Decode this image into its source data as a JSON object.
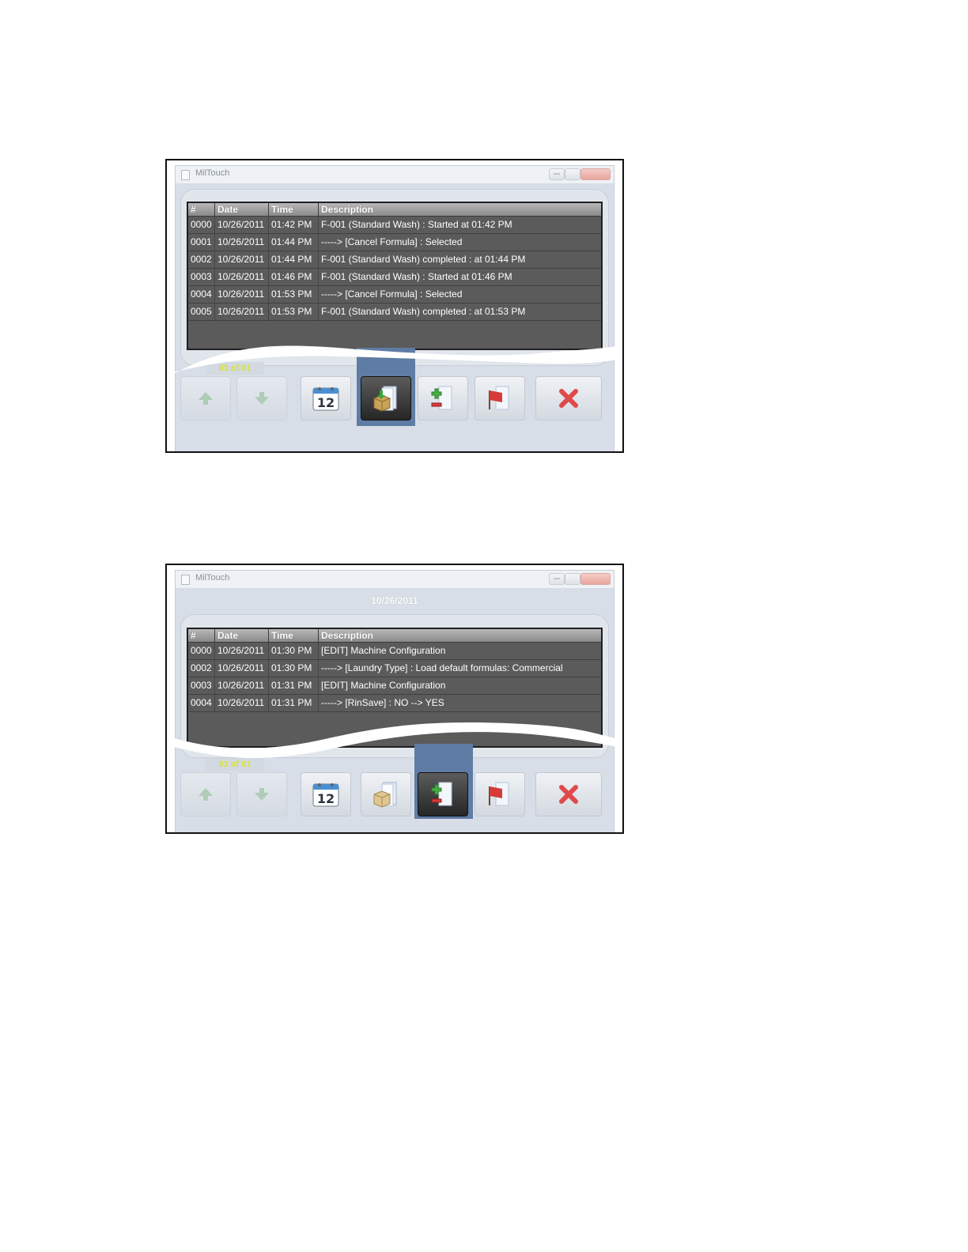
{
  "screens": [
    {
      "window_title": "MilTouch",
      "columns": [
        "#",
        "Date",
        "Time",
        "Description"
      ],
      "rows": [
        {
          "num": "0000",
          "date": "10/26/2011",
          "time": "01:42 PM",
          "desc": "F-001 (Standard Wash) : Started at 01:42 PM"
        },
        {
          "num": "0001",
          "date": "10/26/2011",
          "time": "01:44 PM",
          "desc": "-----> [Cancel Formula] : Selected"
        },
        {
          "num": "0002",
          "date": "10/26/2011",
          "time": "01:44 PM",
          "desc": "F-001 (Standard Wash) completed : at 01:44 PM"
        },
        {
          "num": "0003",
          "date": "10/26/2011",
          "time": "01:46 PM",
          "desc": "F-001 (Standard Wash) : Started at 01:46 PM"
        },
        {
          "num": "0004",
          "date": "10/26/2011",
          "time": "01:53 PM",
          "desc": "-----> [Cancel Formula] : Selected"
        },
        {
          "num": "0005",
          "date": "10/26/2011",
          "time": "01:53 PM",
          "desc": "F-001 (Standard Wash) completed : at 01:53 PM"
        }
      ],
      "page_indicator": "01 of 01",
      "calendar_day": "12",
      "selected_button": "formula-log"
    },
    {
      "window_title": "MilTouch",
      "date_caption": "10/26/2011",
      "columns": [
        "#",
        "Date",
        "Time",
        "Description"
      ],
      "rows": [
        {
          "num": "0000",
          "date": "10/26/2011",
          "time": "01:30 PM",
          "desc": "[EDIT] Machine Configuration"
        },
        {
          "num": "0002",
          "date": "10/26/2011",
          "time": "01:30 PM",
          "desc": "-----> [Laundry Type] : Load default formulas: Commercial"
        },
        {
          "num": "0003",
          "date": "10/26/2011",
          "time": "01:31 PM",
          "desc": "[EDIT] Machine Configuration"
        },
        {
          "num": "0004",
          "date": "10/26/2011",
          "time": "01:31 PM",
          "desc": "-----> [RinSave] : NO --> YES"
        }
      ],
      "page_indicator": "01 of 01",
      "calendar_day": "12",
      "selected_button": "edit-log"
    }
  ]
}
